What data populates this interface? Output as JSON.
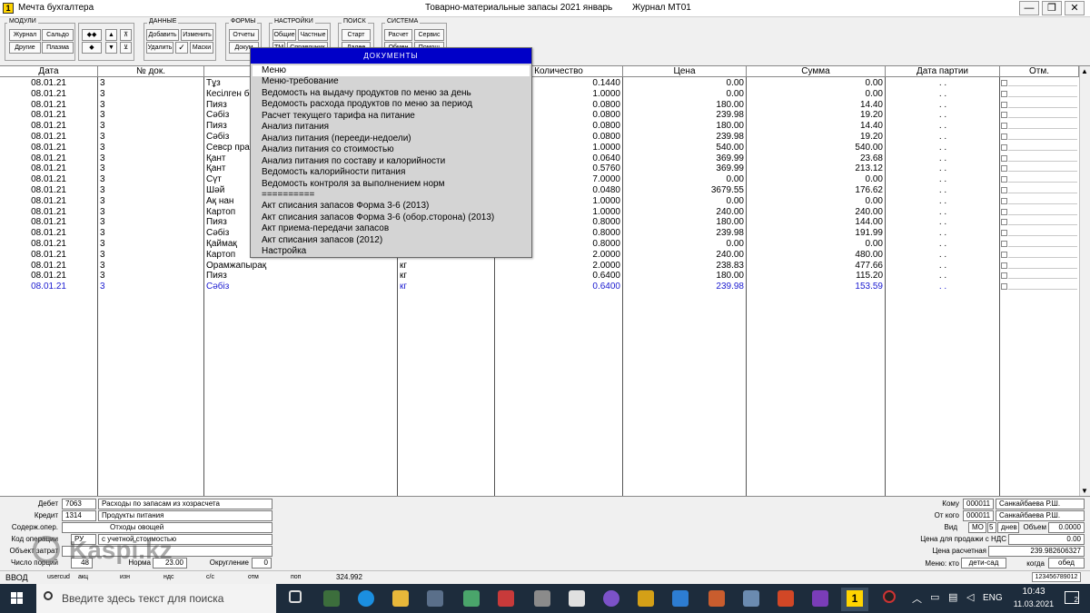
{
  "window": {
    "app_icon": "1",
    "app_title": "Мечта бухгалтера",
    "center_title": "Товарно-материальные запасы 2021 январь",
    "journal_title": "Журнал МТ01",
    "buttons": [
      "—",
      "❐",
      "✕"
    ]
  },
  "toolbar": {
    "groups": {
      "modules": "МОДУЛИ",
      "data": "ДАННЫЕ",
      "forms": "ФОРМЫ",
      "settings": "НАСТРОЙКИ",
      "search": "ПОИСК",
      "system": "СИСТЕМА"
    },
    "modules": {
      "journal": "Журнал",
      "saldo": "Сальдо",
      "other": "Другие",
      "plasma": "Плазма"
    },
    "arrows": {
      "lr": "◆◆",
      "up": "▲",
      "top": "⊼",
      "left": "◆",
      "down": "▼",
      "bottom": "⊻"
    },
    "data": {
      "add": "Добавить",
      "edit": "Изменить",
      "delete": "Удалить",
      "check": "✓",
      "masks": "Маски"
    },
    "forms": {
      "reports": "Отчеты",
      "docs": "Докум"
    },
    "settings": {
      "general": "Общие",
      "private": "Частные",
      "tm": "ТМ",
      "refs": "Справочник"
    },
    "search": {
      "start": "Старт",
      "next": "Далее"
    },
    "system": {
      "calc": "Расчет",
      "service": "Сервис",
      "exchange": "Обмен",
      "help": "Помощ"
    }
  },
  "table": {
    "headers": [
      "Дата",
      "№ док.",
      "",
      "",
      "Количество",
      "Цена",
      "Сумма",
      "Дата партии",
      "Отм."
    ],
    "rows": [
      {
        "date": "08.01.21",
        "doc": "3",
        "name": "Тұз",
        "unit": "",
        "qty": "0.1440",
        "price": "0.00",
        "sum": "0.00",
        "batch": ". ."
      },
      {
        "date": "08.01.21",
        "doc": "3",
        "name": "Кесілген бе",
        "unit": "",
        "qty": "1.0000",
        "price": "0.00",
        "sum": "0.00",
        "batch": ". ."
      },
      {
        "date": "08.01.21",
        "doc": "3",
        "name": "Пияз",
        "unit": "",
        "qty": "0.0800",
        "price": "180.00",
        "sum": "14.40",
        "batch": ". ."
      },
      {
        "date": "08.01.21",
        "doc": "3",
        "name": "Сәбіз",
        "unit": "",
        "qty": "0.0800",
        "price": "239.98",
        "sum": "19.20",
        "batch": ". ."
      },
      {
        "date": "08.01.21",
        "doc": "3",
        "name": "Пияз",
        "unit": "",
        "qty": "0.0800",
        "price": "180.00",
        "sum": "14.40",
        "batch": ". ."
      },
      {
        "date": "08.01.21",
        "doc": "3",
        "name": "Сәбіз",
        "unit": "",
        "qty": "0.0800",
        "price": "239.98",
        "sum": "19.20",
        "batch": ". ."
      },
      {
        "date": "08.01.21",
        "doc": "3",
        "name": "Севср пра",
        "unit": "",
        "qty": "1.0000",
        "price": "540.00",
        "sum": "540.00",
        "batch": ". ."
      },
      {
        "date": "08.01.21",
        "doc": "3",
        "name": "Қант",
        "unit": "",
        "qty": "0.0640",
        "price": "369.99",
        "sum": "23.68",
        "batch": ". ."
      },
      {
        "date": "08.01.21",
        "doc": "3",
        "name": "Қант",
        "unit": "",
        "qty": "0.5760",
        "price": "369.99",
        "sum": "213.12",
        "batch": ". ."
      },
      {
        "date": "08.01.21",
        "doc": "3",
        "name": "Сүт",
        "unit": "",
        "qty": "7.0000",
        "price": "0.00",
        "sum": "0.00",
        "batch": ". ."
      },
      {
        "date": "08.01.21",
        "doc": "3",
        "name": "Шәй",
        "unit": "",
        "qty": "0.0480",
        "price": "3679.55",
        "sum": "176.62",
        "batch": ". ."
      },
      {
        "date": "08.01.21",
        "doc": "3",
        "name": "Ақ нан",
        "unit": "",
        "qty": "1.0000",
        "price": "0.00",
        "sum": "0.00",
        "batch": ". ."
      },
      {
        "date": "08.01.21",
        "doc": "3",
        "name": "Картоп",
        "unit": "",
        "qty": "1.0000",
        "price": "240.00",
        "sum": "240.00",
        "batch": ". ."
      },
      {
        "date": "08.01.21",
        "doc": "3",
        "name": "Пияз",
        "unit": "",
        "qty": "0.8000",
        "price": "180.00",
        "sum": "144.00",
        "batch": ". ."
      },
      {
        "date": "08.01.21",
        "doc": "3",
        "name": "Сәбіз",
        "unit": "",
        "qty": "0.8000",
        "price": "239.98",
        "sum": "191.99",
        "batch": ". ."
      },
      {
        "date": "08.01.21",
        "doc": "3",
        "name": "Қаймақ",
        "unit": "",
        "qty": "0.8000",
        "price": "0.00",
        "sum": "0.00",
        "batch": ". ."
      },
      {
        "date": "08.01.21",
        "doc": "3",
        "name": "Картоп",
        "unit": "",
        "qty": "2.0000",
        "price": "240.00",
        "sum": "480.00",
        "batch": ". ."
      },
      {
        "date": "08.01.21",
        "doc": "3",
        "name": "Орамжапырақ",
        "unit": "кг",
        "qty": "2.0000",
        "price": "238.83",
        "sum": "477.66",
        "batch": ". ."
      },
      {
        "date": "08.01.21",
        "doc": "3",
        "name": "Пияз",
        "unit": "кг",
        "qty": "0.6400",
        "price": "180.00",
        "sum": "115.20",
        "batch": ". ."
      },
      {
        "date": "08.01.21",
        "doc": "3",
        "name": "Сәбіз",
        "unit": "кг",
        "qty": "0.6400",
        "price": "239.98",
        "sum": "153.59",
        "batch": ". .",
        "selected": true
      }
    ]
  },
  "doc_menu": {
    "header": "ДОКУМЕНТЫ",
    "items": [
      "Меню",
      "Меню-требование",
      "Ведомость на выдачу продуктов по меню за день",
      "Ведомость расхода продуктов по меню за период",
      "Расчет текущего тарифа на питание",
      "Анализ питания",
      "Анализ питания (перееди-недоели)",
      "Анализ питания со стоимостью",
      "Анализ питания по составу и калорийности",
      "Ведомость калорийности питания",
      "Ведомость контроля за выполнением норм",
      "==========",
      "Акт списания запасов Форма 3-6 (2013)",
      "Акт списания запасов Форма 3-6 (обор.сторона) (2013)",
      "Акт приема-передачи запасов",
      "Акт списания запасов (2012)",
      "Настройка"
    ]
  },
  "form": {
    "debit_label": "Дебет",
    "debit_code": "7063",
    "debit_name": "Расходы по запасам из хозрасчета",
    "credit_label": "Кредит",
    "credit_code": "1314",
    "credit_name": "Продукты питания",
    "content_label": "Содерж.опер.",
    "content_value": "Отходы овощей",
    "opcode_label": "Код операции",
    "opcode_value": "РУ",
    "opcode_desc": "с учетной стоимостью",
    "object_label": "Объект затрат",
    "object_value": "",
    "portions_label": "Число порций",
    "portions_value": "48",
    "norm_label": "Норма",
    "norm_value": "23.00",
    "rounding_label": "Округление",
    "rounding_value": "0",
    "to_label": "Кому",
    "to_code": "000011",
    "to_name": "Санкайбаева Р.Ш.",
    "from_label": "От кого",
    "from_code": "000011",
    "from_name": "Санкайбаева Р.Ш.",
    "kind_label": "Вид",
    "kind_value": "МО",
    "days_value": "5",
    "days_label": "днев",
    "volume_label": "Объем",
    "volume_value": "0.0000",
    "sale_price_label": "Цена для продажи с НДС",
    "sale_price_value": "0.00",
    "calc_price_label": "Цена расчетная",
    "calc_price_value": "239.982606327",
    "menu_label": "Меню: кто",
    "menu_who": "дети-сад",
    "menu_when_label": "когда",
    "menu_when": "обед"
  },
  "statusbar": {
    "mode": "ВВОД",
    "cols": [
      "usercud",
      "акц",
      "изн",
      "ндс",
      "с/с",
      "отм",
      "поп"
    ],
    "value": "324.992",
    "right_code": "123456789012",
    "watermark": "Kaspi.kz"
  },
  "taskbar": {
    "search_placeholder": "Введите здесь текст для поиска",
    "tray_lang": "ENG",
    "time": "10:43",
    "date": "11.03.2021",
    "notif": "2",
    "app_badge": "1"
  }
}
